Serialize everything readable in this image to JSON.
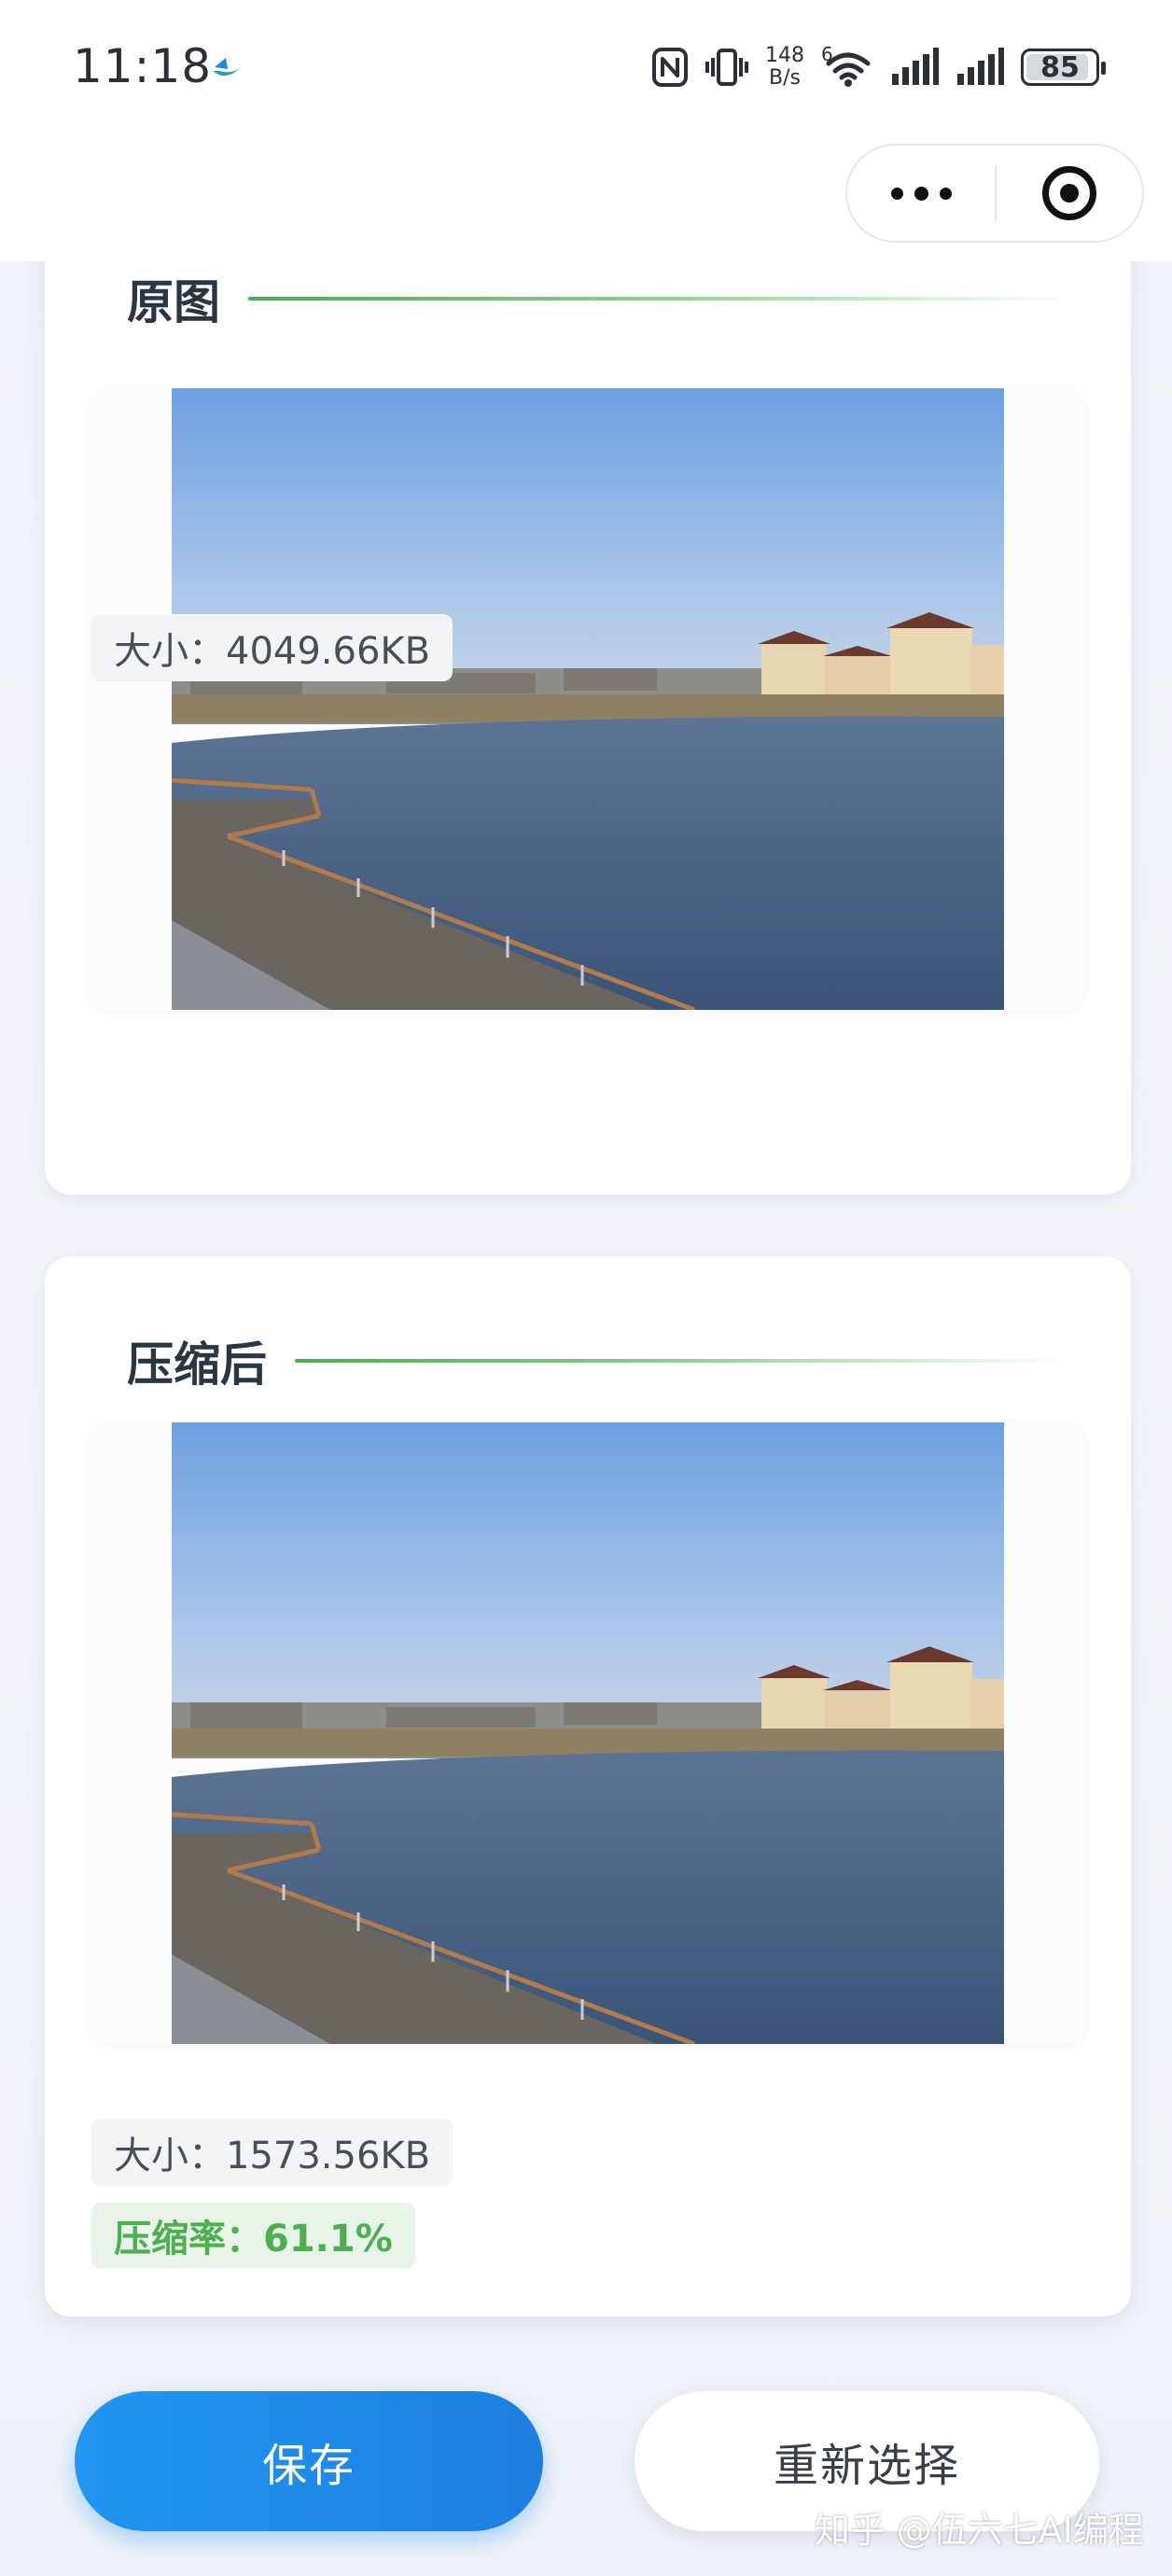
{
  "status_bar": {
    "time": "11:18",
    "net_speed_value": "148",
    "net_speed_unit": "B/s",
    "wifi_label": "6",
    "battery_level": "85",
    "icons": [
      "app-indicator-icon",
      "nfc-icon",
      "vibrate-icon",
      "wifi-icon",
      "signal-icon",
      "signal-icon",
      "battery-icon"
    ]
  },
  "capsule": {
    "more_icon": "more-dots-icon",
    "close_icon": "target-close-icon"
  },
  "original": {
    "title": "原图",
    "size_label": "大小：4049.66KB"
  },
  "compressed": {
    "title": "压缩后",
    "size_label": "大小：1573.56KB",
    "rate_label": "压缩率：61.1%"
  },
  "actions": {
    "save_label": "保存",
    "reselect_label": "重新选择"
  },
  "watermark": "知乎 @伍六七AI编程",
  "colors": {
    "accent_blue": "#2196f3",
    "accent_green": "#4caf50",
    "background": "#eef1f7"
  }
}
